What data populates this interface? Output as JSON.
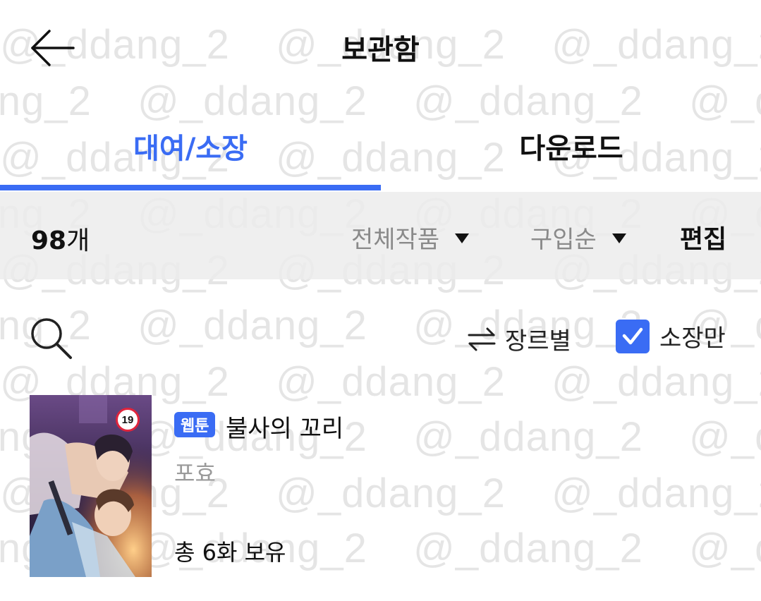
{
  "watermark": "@_ddang_2",
  "header": {
    "title": "보관함",
    "back_icon": "arrow-left-icon"
  },
  "tabs": [
    {
      "label": "대여/소장",
      "active": true
    },
    {
      "label": "다운로드",
      "active": false
    }
  ],
  "filter_bar": {
    "count_value": "98",
    "count_unit": "개",
    "filter_all": "전체작품",
    "sort": "구입순",
    "edit": "편집"
  },
  "toolbar": {
    "search_icon": "search-icon",
    "genre_label": "장르별",
    "genre_icon": "swap-arrows-icon",
    "owned_only_label": "소장만",
    "owned_only_checked": true
  },
  "items": [
    {
      "type_badge": "웹툰",
      "title": "불사의 꼬리",
      "author": "포효",
      "owned": "총 6화 보유",
      "age_rating": "19"
    }
  ],
  "colors": {
    "accent": "#3a6cf4",
    "filter_bg": "#ececec",
    "muted_text": "#8a8a8a"
  }
}
